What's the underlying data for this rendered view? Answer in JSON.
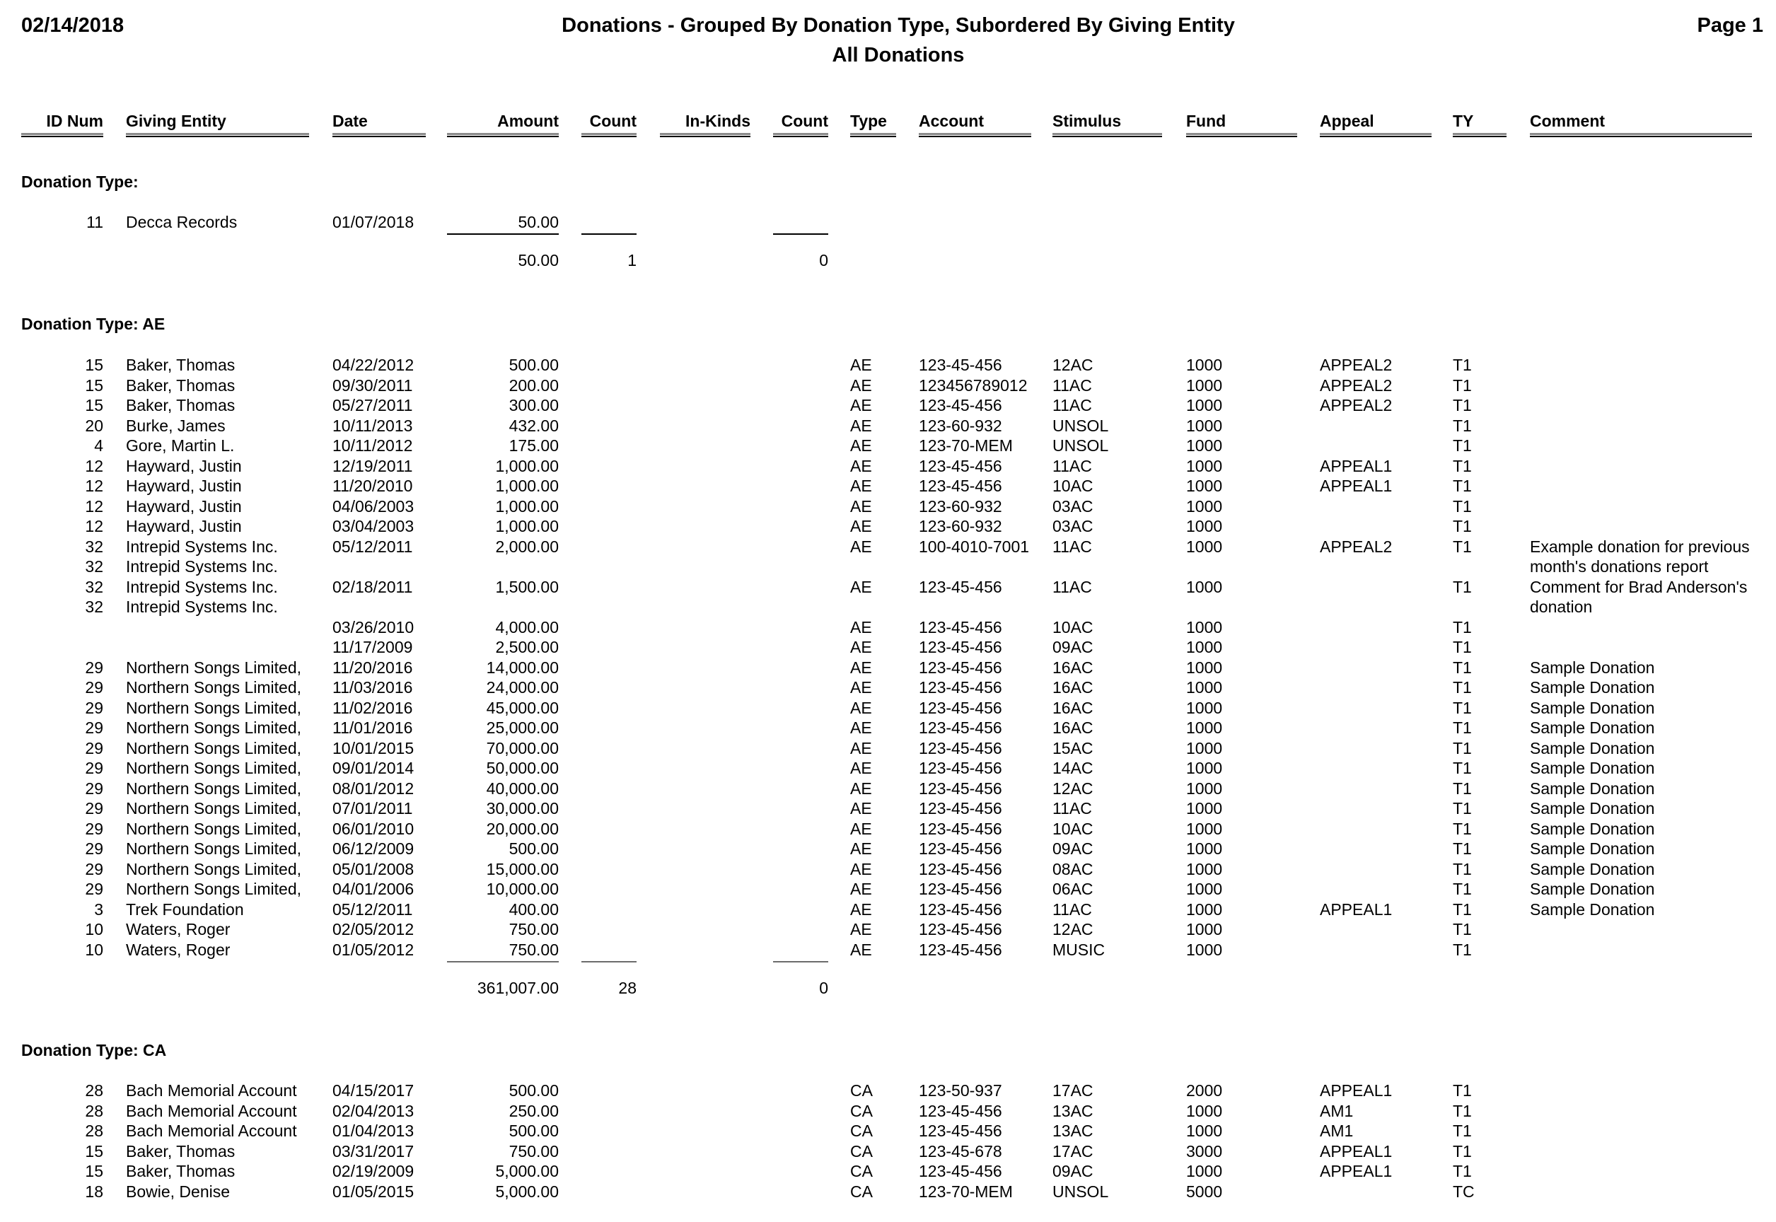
{
  "report": {
    "date": "02/14/2018",
    "title": "Donations - Grouped By Donation Type, Subordered By Giving Entity",
    "subtitle": "All Donations",
    "page": "Page 1"
  },
  "columns": {
    "id_num": "ID Num",
    "giving_entity": "Giving Entity",
    "date": "Date",
    "amount": "Amount",
    "count": "Count",
    "in_kinds": "In-Kinds",
    "count2": "Count",
    "type": "Type",
    "account": "Account",
    "stimulus": "Stimulus",
    "fund": "Fund",
    "appeal": "Appeal",
    "ty": "TY",
    "comment": "Comment"
  },
  "groups": [
    {
      "title": "Donation Type:",
      "rows": [
        {
          "id": "11",
          "entity": "Decca Records",
          "date": "01/07/2018",
          "amount": "50.00",
          "type": "",
          "account": "",
          "stimulus": "",
          "fund": "",
          "appeal": "",
          "ty": "",
          "comment": ""
        }
      ],
      "totals": {
        "amount": "50.00",
        "count": "1",
        "inkind_count": "0"
      }
    },
    {
      "title": "Donation Type: AE",
      "rows": [
        {
          "id": "15",
          "entity": "Baker, Thomas",
          "date": "04/22/2012",
          "amount": "500.00",
          "type": "AE",
          "account": "123-45-456",
          "stimulus": "12AC",
          "fund": "1000",
          "appeal": "APPEAL2",
          "ty": "T1",
          "comment": ""
        },
        {
          "id": "15",
          "entity": "Baker, Thomas",
          "date": "09/30/2011",
          "amount": "200.00",
          "type": "AE",
          "account": "123456789012",
          "stimulus": "11AC",
          "fund": "1000",
          "appeal": "APPEAL2",
          "ty": "T1",
          "comment": ""
        },
        {
          "id": "15",
          "entity": "Baker, Thomas",
          "date": "05/27/2011",
          "amount": "300.00",
          "type": "AE",
          "account": "123-45-456",
          "stimulus": "11AC",
          "fund": "1000",
          "appeal": "APPEAL2",
          "ty": "T1",
          "comment": ""
        },
        {
          "id": "20",
          "entity": "Burke, James",
          "date": "10/11/2013",
          "amount": "432.00",
          "type": "AE",
          "account": "123-60-932",
          "stimulus": "UNSOL",
          "fund": "1000",
          "appeal": "",
          "ty": "T1",
          "comment": ""
        },
        {
          "id": "4",
          "entity": "Gore, Martin L.",
          "date": "10/11/2012",
          "amount": "175.00",
          "type": "AE",
          "account": "123-70-MEM",
          "stimulus": "UNSOL",
          "fund": "1000",
          "appeal": "",
          "ty": "T1",
          "comment": ""
        },
        {
          "id": "12",
          "entity": "Hayward, Justin",
          "date": "12/19/2011",
          "amount": "1,000.00",
          "type": "AE",
          "account": "123-45-456",
          "stimulus": "11AC",
          "fund": "1000",
          "appeal": "APPEAL1",
          "ty": "T1",
          "comment": ""
        },
        {
          "id": "12",
          "entity": "Hayward, Justin",
          "date": "11/20/2010",
          "amount": "1,000.00",
          "type": "AE",
          "account": "123-45-456",
          "stimulus": "10AC",
          "fund": "1000",
          "appeal": "APPEAL1",
          "ty": "T1",
          "comment": ""
        },
        {
          "id": "12",
          "entity": "Hayward, Justin",
          "date": "04/06/2003",
          "amount": "1,000.00",
          "type": "AE",
          "account": "123-60-932",
          "stimulus": "03AC",
          "fund": "1000",
          "appeal": "",
          "ty": "T1",
          "comment": ""
        },
        {
          "id": "12",
          "entity": "Hayward, Justin",
          "date": "03/04/2003",
          "amount": "1,000.00",
          "type": "AE",
          "account": "123-60-932",
          "stimulus": "03AC",
          "fund": "1000",
          "appeal": "",
          "ty": "T1",
          "comment": ""
        },
        {
          "id": "32",
          "entity": "Intrepid Systems Inc.",
          "date": "05/12/2011",
          "amount": "2,000.00",
          "type": "AE",
          "account": "100-4010-7001",
          "stimulus": "11AC",
          "fund": "1000",
          "appeal": "APPEAL2",
          "ty": "T1",
          "comment": "Example donation for previous"
        },
        {
          "id": "32",
          "entity": "Intrepid Systems Inc.",
          "date": "",
          "amount": "",
          "type": "",
          "account": "",
          "stimulus": "",
          "fund": "",
          "appeal": "",
          "ty": "",
          "comment": "month's donations report"
        },
        {
          "id": "32",
          "entity": "Intrepid Systems Inc.",
          "date": "02/18/2011",
          "amount": "1,500.00",
          "type": "AE",
          "account": "123-45-456",
          "stimulus": "11AC",
          "fund": "1000",
          "appeal": "",
          "ty": "T1",
          "comment": "Comment for Brad Anderson's"
        },
        {
          "id": "32",
          "entity": "Intrepid Systems Inc.",
          "date": "",
          "amount": "",
          "type": "",
          "account": "",
          "stimulus": "",
          "fund": "",
          "appeal": "",
          "ty": "",
          "comment": "donation"
        },
        {
          "id": "",
          "entity": "",
          "date": "03/26/2010",
          "amount": "4,000.00",
          "type": "AE",
          "account": "123-45-456",
          "stimulus": "10AC",
          "fund": "1000",
          "appeal": "",
          "ty": "T1",
          "comment": ""
        },
        {
          "id": "",
          "entity": "",
          "date": "11/17/2009",
          "amount": "2,500.00",
          "type": "AE",
          "account": "123-45-456",
          "stimulus": "09AC",
          "fund": "1000",
          "appeal": "",
          "ty": "T1",
          "comment": ""
        },
        {
          "id": "29",
          "entity": "Northern Songs Limited,",
          "date": "11/20/2016",
          "amount": "14,000.00",
          "type": "AE",
          "account": "123-45-456",
          "stimulus": "16AC",
          "fund": "1000",
          "appeal": "",
          "ty": "T1",
          "comment": "Sample Donation"
        },
        {
          "id": "29",
          "entity": "Northern Songs Limited,",
          "date": "11/03/2016",
          "amount": "24,000.00",
          "type": "AE",
          "account": "123-45-456",
          "stimulus": "16AC",
          "fund": "1000",
          "appeal": "",
          "ty": "T1",
          "comment": "Sample Donation"
        },
        {
          "id": "29",
          "entity": "Northern Songs Limited,",
          "date": "11/02/2016",
          "amount": "45,000.00",
          "type": "AE",
          "account": "123-45-456",
          "stimulus": "16AC",
          "fund": "1000",
          "appeal": "",
          "ty": "T1",
          "comment": "Sample Donation"
        },
        {
          "id": "29",
          "entity": "Northern Songs Limited,",
          "date": "11/01/2016",
          "amount": "25,000.00",
          "type": "AE",
          "account": "123-45-456",
          "stimulus": "16AC",
          "fund": "1000",
          "appeal": "",
          "ty": "T1",
          "comment": "Sample Donation"
        },
        {
          "id": "29",
          "entity": "Northern Songs Limited,",
          "date": "10/01/2015",
          "amount": "70,000.00",
          "type": "AE",
          "account": "123-45-456",
          "stimulus": "15AC",
          "fund": "1000",
          "appeal": "",
          "ty": "T1",
          "comment": "Sample Donation"
        },
        {
          "id": "29",
          "entity": "Northern Songs Limited,",
          "date": "09/01/2014",
          "amount": "50,000.00",
          "type": "AE",
          "account": "123-45-456",
          "stimulus": "14AC",
          "fund": "1000",
          "appeal": "",
          "ty": "T1",
          "comment": "Sample Donation"
        },
        {
          "id": "29",
          "entity": "Northern Songs Limited,",
          "date": "08/01/2012",
          "amount": "40,000.00",
          "type": "AE",
          "account": "123-45-456",
          "stimulus": "12AC",
          "fund": "1000",
          "appeal": "",
          "ty": "T1",
          "comment": "Sample Donation"
        },
        {
          "id": "29",
          "entity": "Northern Songs Limited,",
          "date": "07/01/2011",
          "amount": "30,000.00",
          "type": "AE",
          "account": "123-45-456",
          "stimulus": "11AC",
          "fund": "1000",
          "appeal": "",
          "ty": "T1",
          "comment": "Sample Donation"
        },
        {
          "id": "29",
          "entity": "Northern Songs Limited,",
          "date": "06/01/2010",
          "amount": "20,000.00",
          "type": "AE",
          "account": "123-45-456",
          "stimulus": "10AC",
          "fund": "1000",
          "appeal": "",
          "ty": "T1",
          "comment": "Sample Donation"
        },
        {
          "id": "29",
          "entity": "Northern Songs Limited,",
          "date": "06/12/2009",
          "amount": "500.00",
          "type": "AE",
          "account": "123-45-456",
          "stimulus": "09AC",
          "fund": "1000",
          "appeal": "",
          "ty": "T1",
          "comment": "Sample Donation"
        },
        {
          "id": "29",
          "entity": "Northern Songs Limited,",
          "date": "05/01/2008",
          "amount": "15,000.00",
          "type": "AE",
          "account": "123-45-456",
          "stimulus": "08AC",
          "fund": "1000",
          "appeal": "",
          "ty": "T1",
          "comment": "Sample Donation"
        },
        {
          "id": "29",
          "entity": "Northern Songs Limited,",
          "date": "04/01/2006",
          "amount": "10,000.00",
          "type": "AE",
          "account": "123-45-456",
          "stimulus": "06AC",
          "fund": "1000",
          "appeal": "",
          "ty": "T1",
          "comment": "Sample Donation"
        },
        {
          "id": "3",
          "entity": "Trek Foundation",
          "date": "05/12/2011",
          "amount": "400.00",
          "type": "AE",
          "account": "123-45-456",
          "stimulus": "11AC",
          "fund": "1000",
          "appeal": "APPEAL1",
          "ty": "T1",
          "comment": "Sample Donation"
        },
        {
          "id": "10",
          "entity": "Waters, Roger",
          "date": "02/05/2012",
          "amount": "750.00",
          "type": "AE",
          "account": "123-45-456",
          "stimulus": "12AC",
          "fund": "1000",
          "appeal": "",
          "ty": "T1",
          "comment": ""
        },
        {
          "id": "10",
          "entity": "Waters, Roger",
          "date": "01/05/2012",
          "amount": "750.00",
          "type": "AE",
          "account": "123-45-456",
          "stimulus": "MUSIC",
          "fund": "1000",
          "appeal": "",
          "ty": "T1",
          "comment": ""
        }
      ],
      "totals": {
        "amount": "361,007.00",
        "count": "28",
        "inkind_count": "0"
      }
    },
    {
      "title": "Donation Type: CA",
      "rows": [
        {
          "id": "28",
          "entity": "Bach Memorial Account",
          "date": "04/15/2017",
          "amount": "500.00",
          "type": "CA",
          "account": "123-50-937",
          "stimulus": "17AC",
          "fund": "2000",
          "appeal": "APPEAL1",
          "ty": "T1",
          "comment": ""
        },
        {
          "id": "28",
          "entity": "Bach Memorial Account",
          "date": "02/04/2013",
          "amount": "250.00",
          "type": "CA",
          "account": "123-45-456",
          "stimulus": "13AC",
          "fund": "1000",
          "appeal": "AM1",
          "ty": "T1",
          "comment": ""
        },
        {
          "id": "28",
          "entity": "Bach Memorial Account",
          "date": "01/04/2013",
          "amount": "500.00",
          "type": "CA",
          "account": "123-45-456",
          "stimulus": "13AC",
          "fund": "1000",
          "appeal": "AM1",
          "ty": "T1",
          "comment": ""
        },
        {
          "id": "15",
          "entity": "Baker, Thomas",
          "date": "03/31/2017",
          "amount": "750.00",
          "type": "CA",
          "account": "123-45-678",
          "stimulus": "17AC",
          "fund": "3000",
          "appeal": "APPEAL1",
          "ty": "T1",
          "comment": ""
        },
        {
          "id": "15",
          "entity": "Baker, Thomas",
          "date": "02/19/2009",
          "amount": "5,000.00",
          "type": "CA",
          "account": "123-45-456",
          "stimulus": "09AC",
          "fund": "1000",
          "appeal": "APPEAL1",
          "ty": "T1",
          "comment": ""
        },
        {
          "id": "18",
          "entity": "Bowie, Denise",
          "date": "01/05/2015",
          "amount": "5,000.00",
          "type": "CA",
          "account": "123-70-MEM",
          "stimulus": "UNSOL",
          "fund": "5000",
          "appeal": "",
          "ty": "TC",
          "comment": ""
        }
      ],
      "totals": null
    }
  ]
}
